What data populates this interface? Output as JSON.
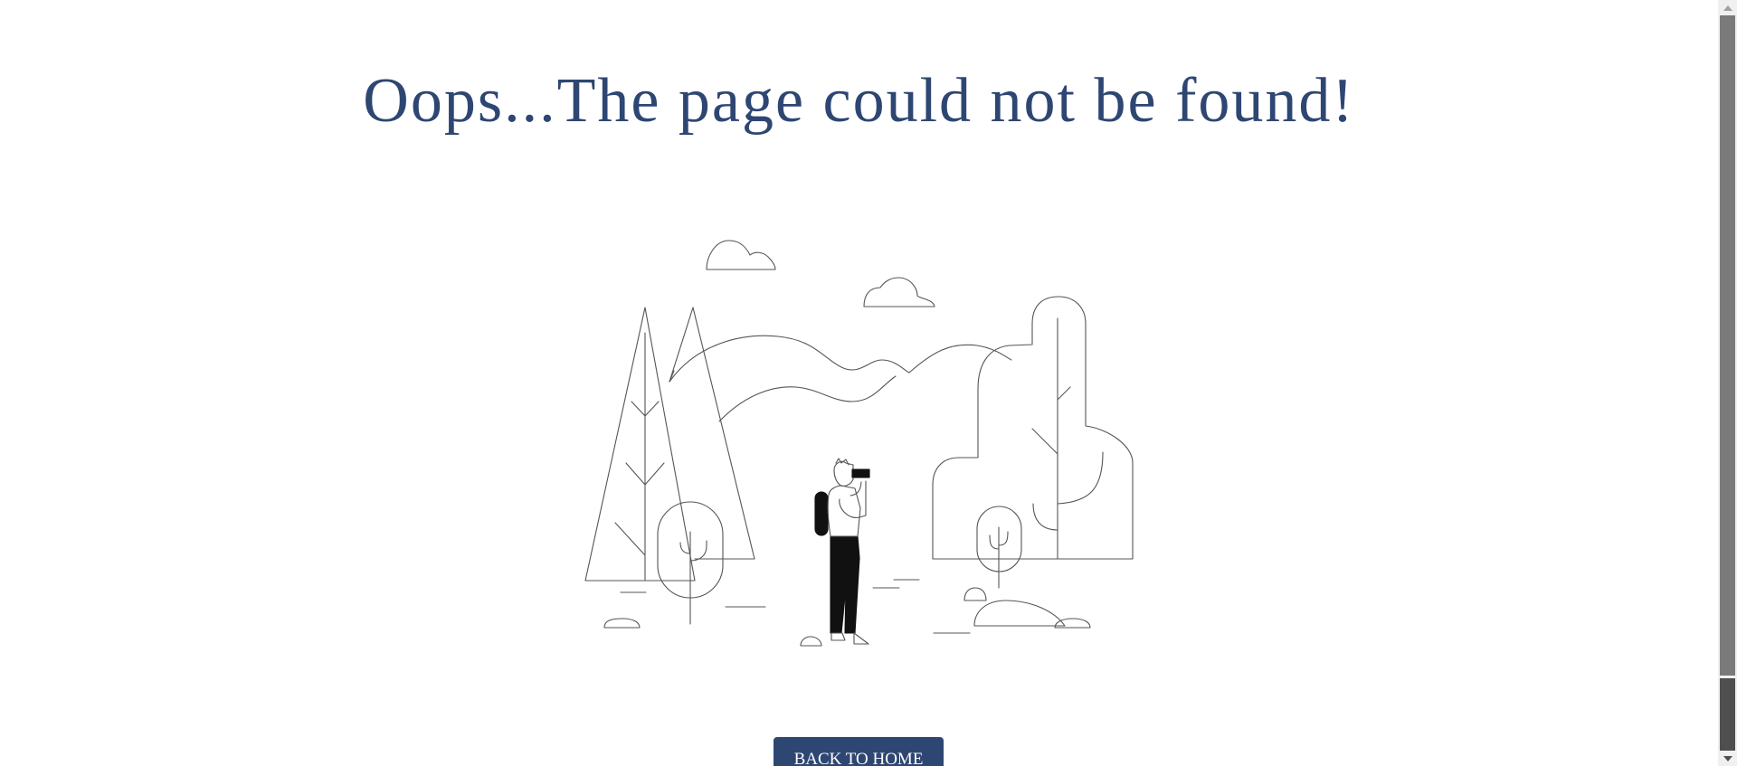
{
  "page": {
    "title": "Oops...The page could not be found!",
    "button_label": "BACK TO HOME",
    "illustration": "hiker-with-binoculars-landscape",
    "colors": {
      "title": "#2e4672",
      "button_bg": "#2e4672",
      "button_text": "#ffffff",
      "line_art": "#555555"
    }
  },
  "scrollbar": {
    "up_icon": "arrow-up-icon",
    "down_icon": "arrow-down-icon"
  }
}
